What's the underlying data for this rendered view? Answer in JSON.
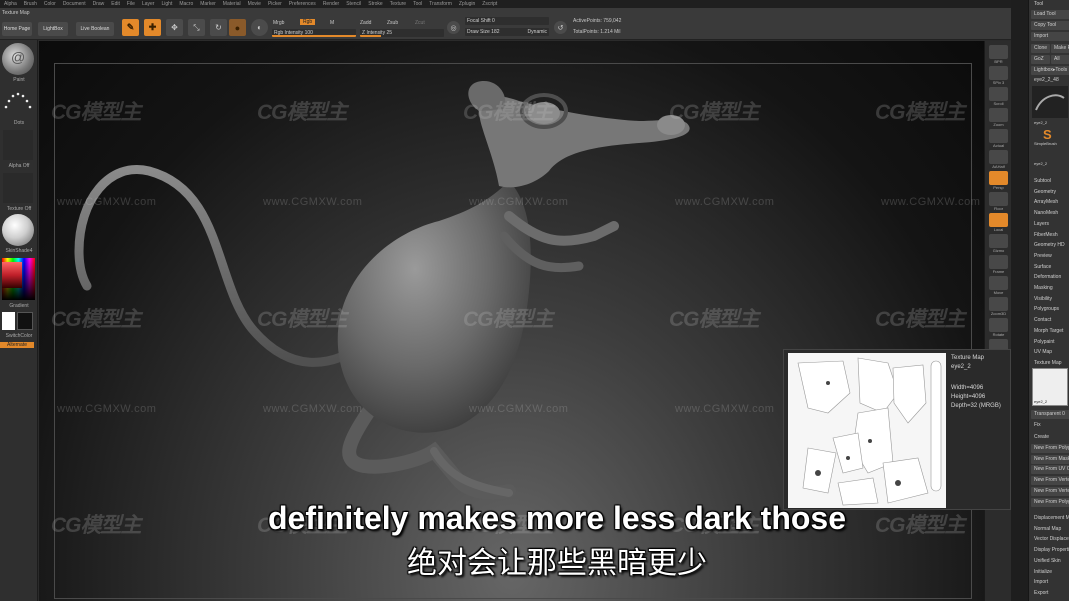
{
  "menubar": {
    "items": [
      "Alpha",
      "Brush",
      "Color",
      "Document",
      "Draw",
      "Edit",
      "File",
      "Layer",
      "Light",
      "Macro",
      "Marker",
      "Material",
      "Movie",
      "Picker",
      "Preferences",
      "Render",
      "Stencil",
      "Stroke",
      "Texture",
      "Tool",
      "Transform",
      "Zplugin",
      "Zscript"
    ]
  },
  "topbar": {
    "texture_map_label": "Texture Map",
    "home_page_label": "Home Page",
    "lightbox_label": "LightBox",
    "live_boolean_label": "Live Boolean",
    "edit_label": "Edit",
    "draw_label": "Draw",
    "move_label": "Move",
    "scale_label": "Scale",
    "rotate_label": "Rotate",
    "mrgb_label": "Mrgb",
    "rgb_label": "Rgb",
    "m_label": "M",
    "zadd_label": "Zadd",
    "zsub_label": "Zsub",
    "zcut_label": "Zcut",
    "rgb_intensity_label": "Rgb Intensity 100",
    "rgb_intensity_value": 100,
    "z_intensity_label": "Z Intensity 25",
    "z_intensity_value": 25,
    "focal_shift_label": "Focal Shift 0",
    "draw_size_label": "Draw Size 182",
    "dynamic_label": "Dynamic",
    "active_points_label": "ActivePoints: 759,042",
    "total_points_label": "TotalPoints: 1.214 Mil"
  },
  "leftbar": {
    "brush_label": "Paint",
    "stroke_label": "Dots",
    "alpha_label": "Alpha Off",
    "texture_label": "Texture Off",
    "material_label": "SkinShade4",
    "gradient_label": "Gradient",
    "switch_color_label": "SwitchColor",
    "alternate_label": "Alternate",
    "colors": {
      "accent": "#e3892a",
      "picker_red": "#c0202a",
      "main_color": "#ffffff",
      "secondary_color": "#111111"
    }
  },
  "rightshelf": {
    "buttons": [
      "BPR",
      "SPix 3",
      "Scroll",
      "Zoom",
      "Actual",
      "AAHalf",
      "Persp",
      "Floor",
      "Local",
      "Gizmo",
      "Frame",
      "Move",
      "Zoom3D",
      "Rotate",
      "Transp",
      "Ghost",
      "Solo",
      "Xpose"
    ]
  },
  "toolpanel": {
    "title": "Tool",
    "load_tool": "Load Tool",
    "copy_tool": "Copy Tool",
    "import": "Import",
    "clone": "Clone",
    "make_polymesh": "Make PolyMesh3D",
    "goz": "GoZ",
    "all": "All",
    "lightbox_tools": "Lightbox▸Tools",
    "current_tool": "eye2_2_48",
    "thumb_labels": [
      "eye2_2",
      "SimpleBrush",
      "eye2_2"
    ],
    "sections": [
      "Subtool",
      "Geometry",
      "ArrayMesh",
      "NanoMesh",
      "Layers",
      "FiberMesh",
      "Geometry HD",
      "Preview",
      "Surface",
      "Deformation",
      "Masking",
      "Visibility",
      "Polygroups",
      "Contact",
      "Morph Target",
      "Polypaint",
      "UV Map",
      "Texture Map"
    ],
    "texture_thumb_label": "eye2_2",
    "transparent_label": "Transparent 0",
    "fix_label": "Fix",
    "create_label": "Create",
    "create_items": [
      "New From Polypaint",
      "New From Masking",
      "New From UV Check",
      "New From Vertex",
      "New From Vertex2",
      "New From Polygroups"
    ],
    "bottom_sections": [
      "Displacement Map",
      "Normal Map",
      "Vector Displacement",
      "Display Properties",
      "Unified Skin",
      "Initialize",
      "Import",
      "Export"
    ]
  },
  "watermark": {
    "logo_text": "CG模型主",
    "url_text": "www.CGMXW.com"
  },
  "texture_preview": {
    "title": "Texture Map",
    "name": "eye2_2",
    "width_label": "Width=4096",
    "height_label": "Height=4096",
    "depth_label": "Depth=32 (MRGB)"
  },
  "subtitles": {
    "english": "definitely makes more less dark those",
    "chinese": "绝对会让那些黑暗更少"
  }
}
